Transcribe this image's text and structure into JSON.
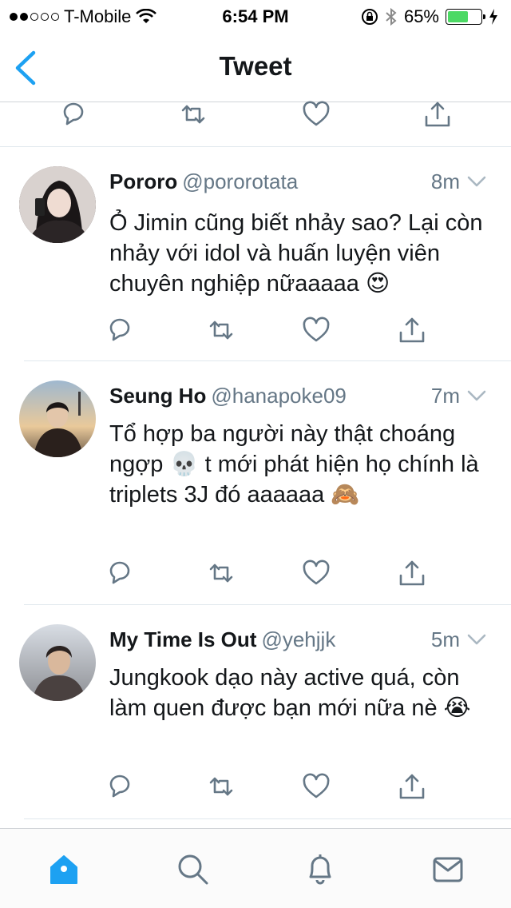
{
  "status_bar": {
    "carrier": "T-Mobile",
    "signal_dots": 2,
    "time": "6:54 PM",
    "battery_percent": "65%",
    "battery_level": 0.65
  },
  "nav": {
    "title": "Tweet",
    "back_icon": "chevron-left-icon"
  },
  "colors": {
    "accent": "#1da1f2",
    "text": "#14171a",
    "secondary": "#657786",
    "icon": "#657786",
    "battery": "#4cd964"
  },
  "tweets": [
    {
      "name": "Pororo",
      "handle": "@pororotata",
      "time": "8m",
      "text": "Ỏ Jimin cũng biết nhảy sao? Lại còn nhảy với idol và huấn luyện viên chuyên nghiệp nữaaaaa 😍"
    },
    {
      "name": "Seung Ho",
      "handle": "@hanapoke09",
      "time": "7m",
      "text": "Tổ hợp ba người này thật choáng ngợp 💀  t mới phát hiện họ chính là triplets 3J đó aaaaaa 🙈"
    },
    {
      "name": "My Time Is Out",
      "handle": "@yehjjk",
      "time": "5m",
      "text": "Jungkook dạo này active quá, còn làm quen được bạn mới nữa nè 😭"
    }
  ],
  "tab_bar": {
    "items": [
      "home-icon",
      "search-icon",
      "notifications-icon",
      "messages-icon"
    ],
    "active": "home-icon"
  }
}
